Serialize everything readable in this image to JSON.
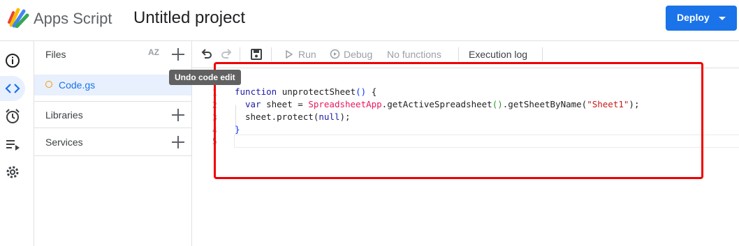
{
  "header": {
    "app_name": "Apps Script",
    "project_title": "Untitled project",
    "deploy_label": "Deploy"
  },
  "rail": {
    "items": [
      {
        "icon": "info-icon"
      },
      {
        "icon": "code-icon",
        "active": true
      },
      {
        "icon": "alarm-clock-icon"
      },
      {
        "icon": "executions-icon"
      },
      {
        "icon": "settings-gear-icon"
      }
    ]
  },
  "files_panel": {
    "title": "Files",
    "sort_label": "AZ",
    "files": [
      {
        "name": "Code.gs"
      }
    ],
    "libraries_label": "Libraries",
    "services_label": "Services"
  },
  "toolbar": {
    "run_label": "Run",
    "debug_label": "Debug",
    "function_select": "No functions",
    "execution_log_label": "Execution log"
  },
  "tooltip": {
    "text": "Undo code edit"
  },
  "editor": {
    "line_numbers": [
      "1",
      "2",
      "3",
      "4",
      "5"
    ],
    "code": {
      "l1_kw": "function",
      "l1_name": " unprotectSheet",
      "l1_paren": "()",
      "l1_brace": " {",
      "l2_kw": "var",
      "l2_a": " sheet = ",
      "l2_cls": "SpreadsheetApp",
      "l2_b": ".getActiveSpreadsheet",
      "l2_p": "()",
      "l2_c": ".getSheetByName(",
      "l2_str": "\"Sheet1\"",
      "l2_d": ");",
      "l3_a": "sheet.protect(",
      "l3_kw": "null",
      "l3_b": ");",
      "l4": "}"
    }
  },
  "annotation": {
    "highlight_color": "#f00000"
  },
  "colors": {
    "accent": "#1a73e8",
    "active_bg": "#e8f0fe"
  }
}
